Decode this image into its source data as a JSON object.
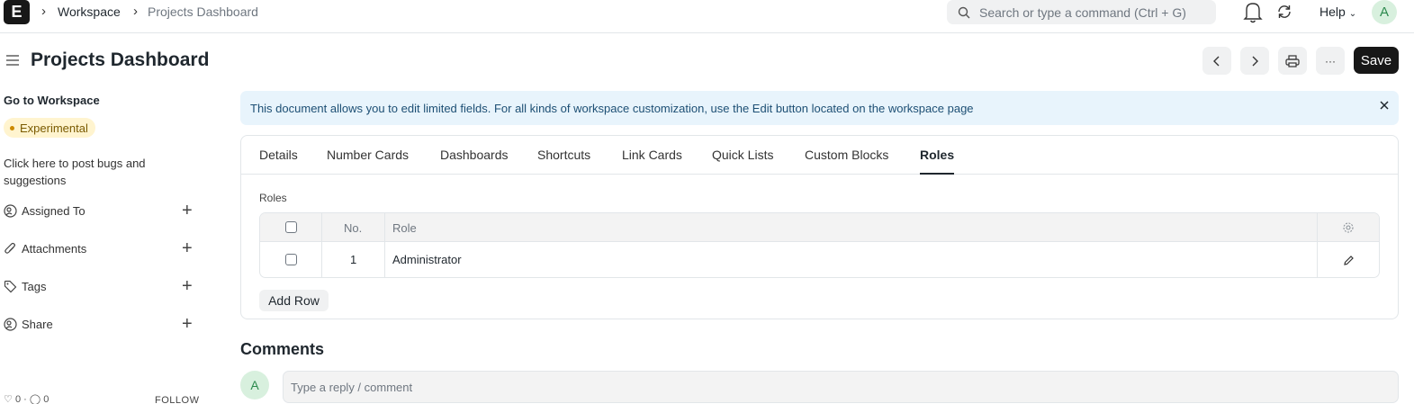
{
  "navbar": {
    "logo_letter": "E",
    "breadcrumbs": [
      "Workspace",
      "Projects Dashboard"
    ],
    "search_placeholder": "Search or type a command (Ctrl + G)",
    "help_label": "Help",
    "avatar_letter": "A"
  },
  "page": {
    "title": "Projects Dashboard",
    "save_label": "Save",
    "more_label": "···"
  },
  "sidebar": {
    "go_to_workspace": "Go to Workspace",
    "experimental_badge": "Experimental",
    "bug_link": "Click here to post bugs and suggestions",
    "items": [
      {
        "label": "Assigned To",
        "icon": "user-at-icon"
      },
      {
        "label": "Attachments",
        "icon": "paperclip-icon"
      },
      {
        "label": "Tags",
        "icon": "tag-icon"
      },
      {
        "label": "Share",
        "icon": "share-user-icon"
      }
    ],
    "likes": "0",
    "comments": "0",
    "follow_label": "FOLLOW"
  },
  "notice": {
    "text": "This document allows you to edit limited fields. For all kinds of workspace customization, use the Edit button located on the workspace page"
  },
  "tabs": [
    "Details",
    "Number Cards",
    "Dashboards",
    "Shortcuts",
    "Link Cards",
    "Quick Lists",
    "Custom Blocks",
    "Roles"
  ],
  "active_tab": "Roles",
  "roles": {
    "field_label": "Roles",
    "columns": {
      "no": "No.",
      "role": "Role"
    },
    "rows": [
      {
        "no": "1",
        "role": "Administrator"
      }
    ],
    "add_row_label": "Add Row"
  },
  "comments": {
    "title": "Comments",
    "avatar_letter": "A",
    "placeholder": "Type a reply / comment"
  },
  "colors": {
    "primary_dark": "#171717",
    "notice_bg": "#e8f4fc",
    "notice_text": "#1d4f74",
    "badge_bg": "#fff4cf",
    "avatar_bg": "#d8f0de"
  }
}
